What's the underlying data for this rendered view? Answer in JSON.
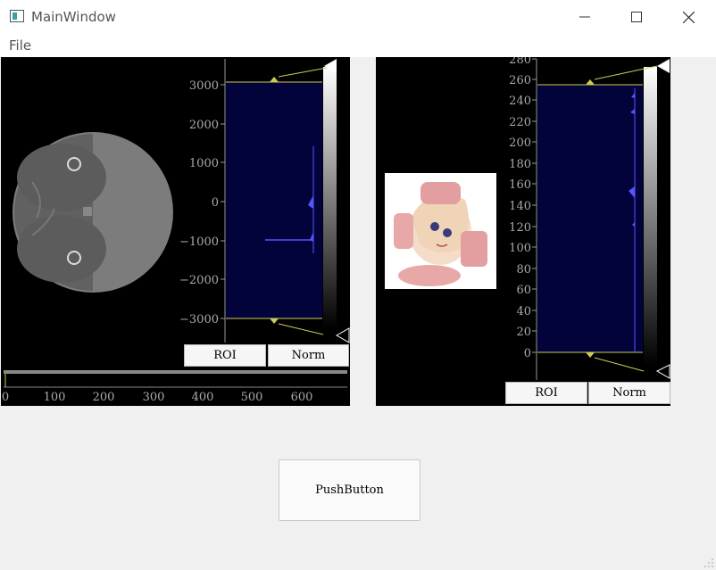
{
  "window": {
    "title": "MainWindow",
    "min_glyph": "—",
    "max_glyph": "☐",
    "close_glyph": "✕"
  },
  "menu": {
    "file": "File"
  },
  "left_histogram": {
    "ticks": [
      "3000",
      "2000",
      "1000",
      "0",
      "−1000",
      "−2000",
      "−3000"
    ]
  },
  "right_histogram": {
    "ticks": [
      "280",
      "260",
      "240",
      "220",
      "200",
      "180",
      "160",
      "140",
      "120",
      "100",
      "80",
      "60",
      "40",
      "20",
      "0"
    ]
  },
  "slider_axis": {
    "ticks": [
      "0",
      "100",
      "200",
      "300",
      "400",
      "500",
      "600"
    ]
  },
  "buttons": {
    "roi": "ROI",
    "norm": "Norm",
    "push": "PushButton"
  },
  "colors": {
    "histogram_bg": "#03033b",
    "level_line": "#cccc55",
    "curve": "#5555ff"
  }
}
